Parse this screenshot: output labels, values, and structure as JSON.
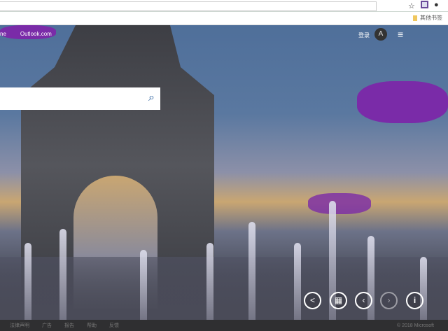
{
  "browser": {
    "address_value": "",
    "bookmarks_folder": "其他书签",
    "icons": [
      "star-icon",
      "extension-icon",
      "extension-icon-2"
    ]
  },
  "header": {
    "nav": [
      "ne",
      "Outlook.com"
    ],
    "signin": "登录",
    "avatar_glyph": "A",
    "menu_glyph": "≡"
  },
  "search": {
    "value": "",
    "icon": "⌕"
  },
  "hero_controls": [
    {
      "name": "share",
      "glyph": "<"
    },
    {
      "name": "qr-code",
      "glyph": "▦"
    },
    {
      "name": "previous",
      "glyph": "‹"
    },
    {
      "name": "next",
      "glyph": "›"
    },
    {
      "name": "info",
      "glyph": "i"
    }
  ],
  "footer": {
    "links": [
      "法律声明",
      "广告",
      "报告",
      "帮助",
      "反馈"
    ],
    "copyright": "© 2018 Microsoft"
  },
  "colors": {
    "accent": "#235a9a",
    "footer_bg": "#2f2f31"
  }
}
